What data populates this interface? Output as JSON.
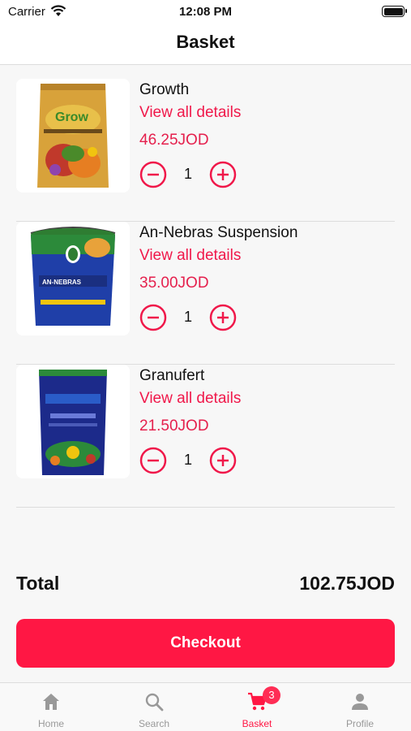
{
  "status_bar": {
    "carrier": "Carrier",
    "time": "12:08 PM"
  },
  "header": {
    "title": "Basket"
  },
  "basket": {
    "items": [
      {
        "name": "Growth",
        "details_link": "View all details",
        "price": "46.25JOD",
        "quantity": "1"
      },
      {
        "name": "An-Nebras Suspension",
        "details_link": "View all details",
        "price": "35.00JOD",
        "quantity": "1"
      },
      {
        "name": "Granufert",
        "details_link": "View all details",
        "price": "21.50JOD",
        "quantity": "1"
      }
    ]
  },
  "summary": {
    "total_label": "Total",
    "total_value": "102.75JOD",
    "checkout_label": "Checkout"
  },
  "tab_bar": {
    "tabs": [
      {
        "label": "Home",
        "icon": "home-icon"
      },
      {
        "label": "Search",
        "icon": "search-icon"
      },
      {
        "label": "Basket",
        "icon": "cart-icon",
        "badge": "3"
      },
      {
        "label": "Profile",
        "icon": "person-icon"
      }
    ]
  },
  "colors": {
    "accent": "#ff1744",
    "price": "#e5204d",
    "inactive": "#999999"
  }
}
